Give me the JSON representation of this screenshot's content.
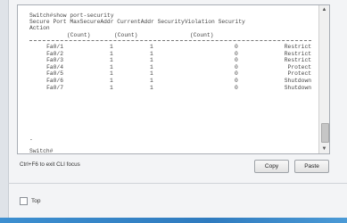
{
  "terminal": {
    "lines_top": [
      "Switch#show port-security",
      "Secure Port MaxSecureAddr CurrentAddr SecurityViolation Security",
      "Action"
    ],
    "count_headers": [
      "(Count)",
      "(Count)",
      "(Count)"
    ],
    "rows": [
      {
        "port": "Fa0/1",
        "max": "1",
        "current": "1",
        "violation": "0",
        "action": "Restrict"
      },
      {
        "port": "Fa0/2",
        "max": "1",
        "current": "1",
        "violation": "0",
        "action": "Restrict"
      },
      {
        "port": "Fa0/3",
        "max": "1",
        "current": "1",
        "violation": "0",
        "action": "Restrict"
      },
      {
        "port": "Fa0/4",
        "max": "1",
        "current": "1",
        "violation": "0",
        "action": "Protect"
      },
      {
        "port": "Fa0/5",
        "max": "1",
        "current": "1",
        "violation": "0",
        "action": "Protect"
      },
      {
        "port": "Fa0/6",
        "max": "1",
        "current": "1",
        "violation": "0",
        "action": "Shutdown"
      },
      {
        "port": "Fa0/7",
        "max": "1",
        "current": "1",
        "violation": "0",
        "action": "Shutdown"
      }
    ],
    "cursor_line": "-",
    "prompt": "Switch#"
  },
  "hint": "Ctrl+F6 to exit CLI focus",
  "buttons": {
    "copy": "Copy",
    "paste": "Paste"
  },
  "top_checkbox": {
    "label": "Top",
    "checked": false
  }
}
